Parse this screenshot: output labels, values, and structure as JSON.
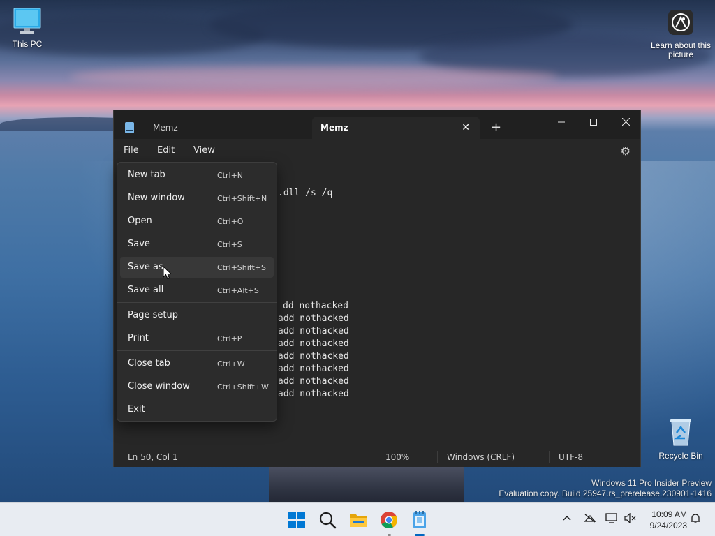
{
  "desktop": {
    "icons": [
      {
        "label": "This PC"
      },
      {
        "label": "Learn about this picture"
      },
      {
        "label": "Recycle Bin"
      }
    ],
    "watermark": {
      "line1": "Windows 11 Pro Insider Preview",
      "line2": "Evaluation copy. Build 25947.rs_prerelease.230901-1416"
    }
  },
  "window": {
    "tabs": [
      {
        "label": "Memz",
        "active": false
      },
      {
        "label": "Memz",
        "active": true
      }
    ],
    "menus": [
      {
        "label": "File"
      },
      {
        "label": "Edit"
      },
      {
        "label": "View"
      }
    ],
    "editor_lines": [
      ".dll /s /q",
      "dd nothacked",
      "add nothacked",
      "add nothacked",
      "add nothacked",
      "add nothacked",
      "add nothacked",
      "add nothacked",
      "add nothacked"
    ],
    "status": {
      "position": "Ln 50, Col 1",
      "zoom": "100%",
      "line_endings": "Windows (CRLF)",
      "encoding": "UTF-8"
    }
  },
  "file_menu": {
    "items": [
      {
        "label": "New tab",
        "shortcut": "Ctrl+N"
      },
      {
        "label": "New window",
        "shortcut": "Ctrl+Shift+N"
      },
      {
        "label": "Open",
        "shortcut": "Ctrl+O"
      },
      {
        "label": "Save",
        "shortcut": "Ctrl+S"
      },
      {
        "label": "Save as",
        "shortcut": "Ctrl+Shift+S",
        "hovered": true
      },
      {
        "label": "Save all",
        "shortcut": "Ctrl+Alt+S"
      },
      {
        "label": "Page setup",
        "shortcut": ""
      },
      {
        "label": "Print",
        "shortcut": "Ctrl+P"
      },
      {
        "label": "Close tab",
        "shortcut": "Ctrl+W"
      },
      {
        "label": "Close window",
        "shortcut": "Ctrl+Shift+W"
      },
      {
        "label": "Exit",
        "shortcut": ""
      }
    ]
  },
  "taskbar": {
    "clock_time": "10:09 AM",
    "clock_date": "9/24/2023",
    "icons": [
      "start-icon",
      "search-icon",
      "file-explorer-icon",
      "chrome-icon",
      "notepad-icon"
    ]
  },
  "colors": {
    "window_bg": "#272727",
    "titlebar_bg": "#202020",
    "menu_bg": "#2c2c2c",
    "accent": "#0067c0",
    "taskbar_bg": "#e8ecf2"
  }
}
